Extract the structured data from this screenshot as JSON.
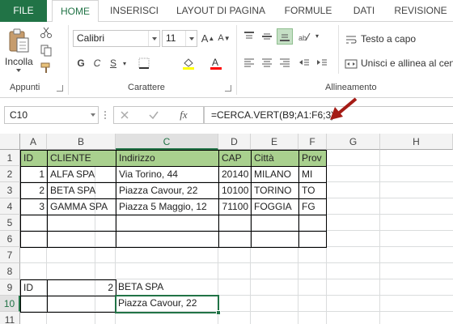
{
  "ribbon_tabs": [
    "FILE",
    "HOME",
    "INSERISCI",
    "LAYOUT DI PAGINA",
    "FORMULE",
    "DATI",
    "REVISIONE"
  ],
  "clipboard": {
    "paste_label": "Incolla",
    "group_label": "Appunti"
  },
  "font": {
    "name": "Calibri",
    "size": "11",
    "bold": "G",
    "italic": "C",
    "underline": "S",
    "group_label": "Carattere"
  },
  "alignment": {
    "wrap_text": "Testo a capo",
    "merge_center": "Unisci e allinea al centro",
    "group_label": "Allineamento"
  },
  "formula_bar": {
    "name_box": "C10",
    "fx": "fx",
    "formula": "=CERCA.VERT(B9;A1:F6;3)"
  },
  "columns": [
    "A",
    "B",
    "C",
    "D",
    "E",
    "F",
    "G",
    "H"
  ],
  "rows": [
    "1",
    "2",
    "3",
    "4",
    "5",
    "6",
    "7",
    "8",
    "9",
    "10",
    "11"
  ],
  "table": {
    "headers": [
      "ID",
      "CLIENTE",
      "Indirizzo",
      "CAP",
      "Città",
      "Prov"
    ],
    "rows": [
      [
        "1",
        "ALFA SPA",
        "Via Torino, 44",
        "20140",
        "MILANO",
        "MI"
      ],
      [
        "2",
        "BETA SPA",
        "Piazza Cavour, 22",
        "10100",
        "TORINO",
        "TO"
      ],
      [
        "3",
        "GAMMA SPA",
        "Piazza 5 Maggio, 12",
        "71100",
        "FOGGIA",
        "FG"
      ]
    ]
  },
  "lookup": {
    "a9": "ID",
    "b9": "2",
    "c9": "BETA SPA",
    "c10": "Piazza Cavour, 22"
  },
  "colors": {
    "excel_green": "#217346",
    "header_fill": "#a9d08e",
    "arrow_red": "#a51c16"
  }
}
